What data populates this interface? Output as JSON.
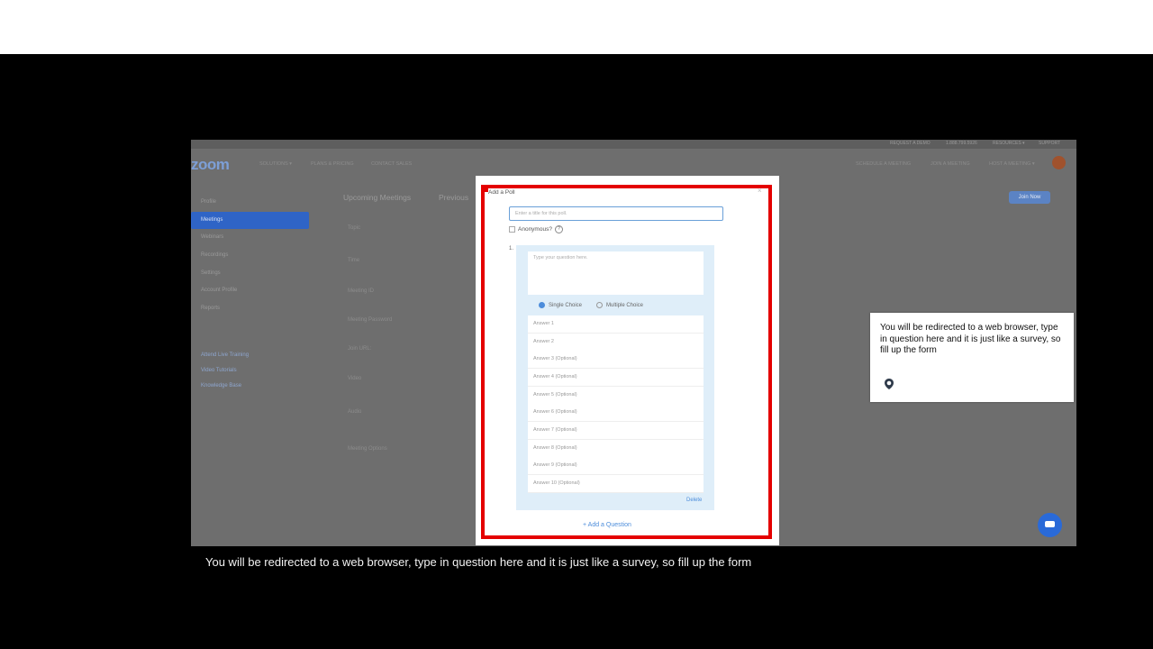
{
  "zoom_app": {
    "logo": "zoom",
    "utility_nav": [
      "REQUEST A DEMO",
      "1.888.799.5926",
      "RESOURCES ▾",
      "SUPPORT"
    ],
    "top_nav_left": [
      "SOLUTIONS ▾",
      "PLANS & PRICING",
      "CONTACT SALES"
    ],
    "top_nav_right": [
      "SCHEDULE A MEETING",
      "JOIN A MEETING",
      "HOST A MEETING ▾"
    ],
    "join_now": "Join Now",
    "sidebar": {
      "items": [
        "Profile",
        "Meetings",
        "Webinars",
        "Recordings",
        "Settings",
        "Account Profile",
        "Reports"
      ],
      "links": [
        "Attend Live Training",
        "Video Tutorials",
        "Knowledge Base"
      ]
    },
    "tabs": [
      "Upcoming Meetings",
      "Previous"
    ],
    "fields": [
      "Topic",
      "Time",
      "Meeting ID",
      "Meeting Password",
      "Join URL:",
      "Video",
      "Audio",
      "Meeting Options"
    ]
  },
  "poll_modal": {
    "title": "Add a Poll",
    "close": "×",
    "title_placeholder": "Enter a title for this poll.",
    "anonymous_label": "Anonymous?",
    "question_number": "1.",
    "question_placeholder": "Type your question here.",
    "single_choice": "Single Choice",
    "multiple_choice": "Multiple Choice",
    "answers": [
      "Answer 1",
      "Answer 2",
      "Answer 3 (Optional)",
      "Answer 4 (Optional)",
      "Answer 5 (Optional)",
      "Answer 6 (Optional)",
      "Answer 7 (Optional)",
      "Answer 8 (Optional)",
      "Answer 9 (Optional)",
      "Answer 10 (Optional)"
    ],
    "delete": "Delete",
    "add_question": "+ Add a Question"
  },
  "tooltip": {
    "text": "You will be redirected to a web browser, type in question here and it is just like a survey, so fill up the form"
  },
  "caption": "You will be redirected to a web browser, type in question here and it is just like a survey, so fill up the form",
  "colors": {
    "highlight_red": "#e40000",
    "zoom_blue": "#2f64c6",
    "chat_blue": "#2a6ad8"
  }
}
